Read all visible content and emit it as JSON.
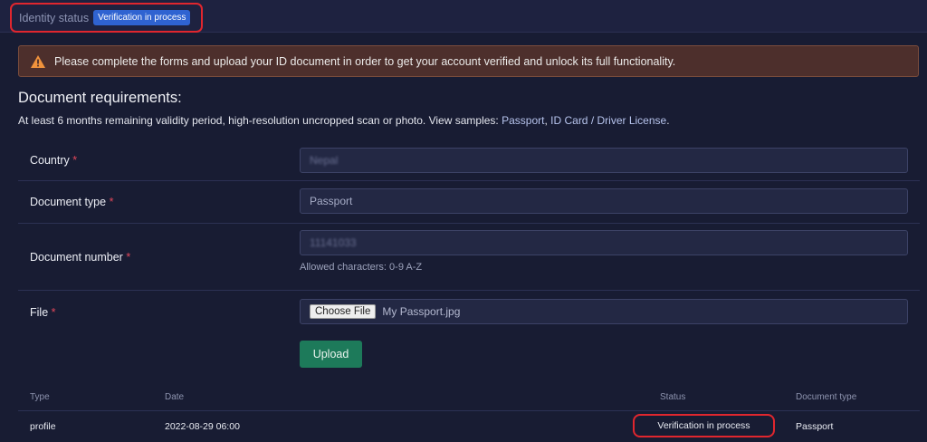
{
  "identity": {
    "label": "Identity status",
    "badge": "Verification in process"
  },
  "alert": {
    "icon": "warning-triangle-icon",
    "text": "Please complete the forms and upload your ID document in order to get your account verified and unlock its full functionality."
  },
  "requirements": {
    "title": "Document requirements:",
    "text": "At least 6 months remaining validity period, high-resolution uncropped scan or photo. View samples:",
    "sample_passport": "Passport",
    "sample_separator": ",",
    "sample_id": "ID Card / Driver License",
    "end": "."
  },
  "form": {
    "country": {
      "label": "Country",
      "required": "*",
      "value": "Nepal"
    },
    "document_type": {
      "label": "Document type",
      "required": "*",
      "value": "Passport"
    },
    "document_number": {
      "label": "Document number",
      "required": "*",
      "value": "11141033",
      "hint": "Allowed characters: 0-9 A-Z"
    },
    "file": {
      "label": "File",
      "required": "*",
      "button": "Choose File",
      "filename": "My Passport.jpg"
    },
    "upload_button": "Upload"
  },
  "table": {
    "headers": {
      "type": "Type",
      "date": "Date",
      "status": "Status",
      "document_type": "Document type"
    },
    "row": {
      "type": "profile",
      "date": "2022-08-29 06:00",
      "status": "Verification in process",
      "document_type": "Passport"
    }
  },
  "colors": {
    "background": "#181c33",
    "badge": "#2f63d1",
    "alert_bg": "#4d2f2c",
    "warning_icon": "#f0923c",
    "highlight_circle": "#e0262e",
    "upload_button": "#1d7a5a"
  }
}
